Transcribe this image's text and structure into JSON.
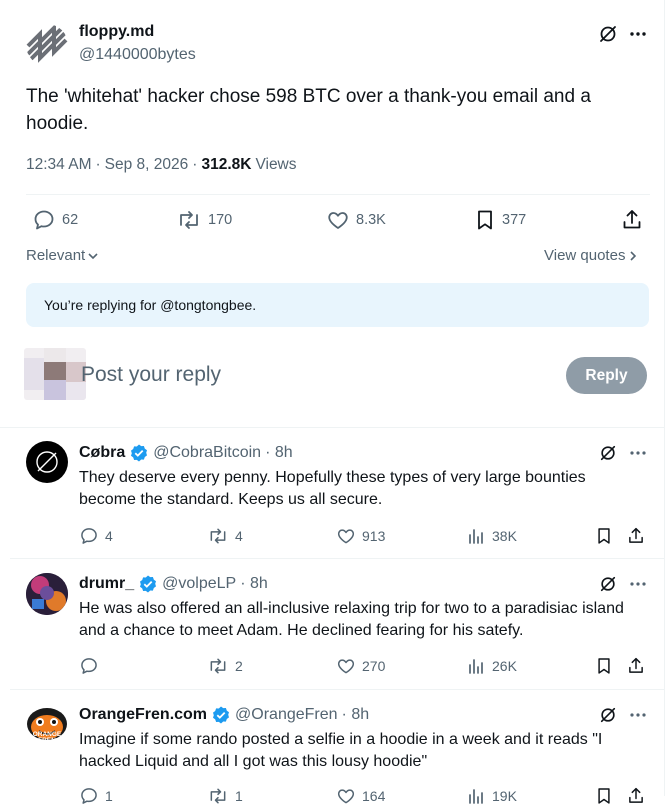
{
  "tweet": {
    "author_name": "floppy.md",
    "author_handle": "@1440000bytes",
    "text": "The 'whitehat' hacker chose 598 BTC over a thank-you email and a hoodie.",
    "time": "12:34 AM",
    "dot1": "·",
    "date": "Sep 8, 2026",
    "dot2": "·",
    "views_count": "312.8K",
    "views_label": "Views",
    "stats": {
      "replies": "62",
      "reposts": "170",
      "likes": "8.3K",
      "bookmarks": "377"
    }
  },
  "sort": {
    "label": "Relevant",
    "view_quotes": "View quotes"
  },
  "replying_notice": "You’re replying for @tongtongbee.",
  "composer": {
    "placeholder": "Post your reply",
    "button": "Reply"
  },
  "replies": [
    {
      "name": "Cøbra",
      "handle": "@CobraBitcoin",
      "time": "· 8h",
      "text": "They deserve every penny. Hopefully these types of very large bounties become the standard. Keeps us all secure.",
      "replies": "4",
      "reposts": "4",
      "likes": "913",
      "views": "38K"
    },
    {
      "name": "drumr_",
      "handle": "@volpeLP",
      "time": "· 8h",
      "text": "He was also offered an all-inclusive relaxing trip for two to a paradisiac island and a chance to meet Adam. He declined fearing for his satefy.",
      "replies": "",
      "reposts": "2",
      "likes": "270",
      "views": "26K"
    },
    {
      "name": "OrangeFren.com",
      "handle": "@OrangeFren",
      "time": "· 8h",
      "text": "Imagine if some rando posted a selfie in a hoodie in a week and it reads \"I hacked Liquid and all I got was this lousy hoodie\"",
      "avatar_text": "ORANGE FREN",
      "replies": "1",
      "reposts": "1",
      "likes": "164",
      "views": "19K"
    }
  ],
  "icons": {
    "more": "more-icon",
    "grok": "grok-icon",
    "verified": "verified-badge-icon",
    "reply": "reply-icon",
    "repost": "repost-icon",
    "like": "like-icon",
    "bookmark": "bookmark-icon",
    "share": "share-icon",
    "views": "views-icon"
  },
  "colors": {
    "accent": "#1d9bf0",
    "text": "#0f1419",
    "muted": "#536471",
    "notice_bg": "#e8f5fd",
    "reply_btn": "#8f9ca7"
  }
}
